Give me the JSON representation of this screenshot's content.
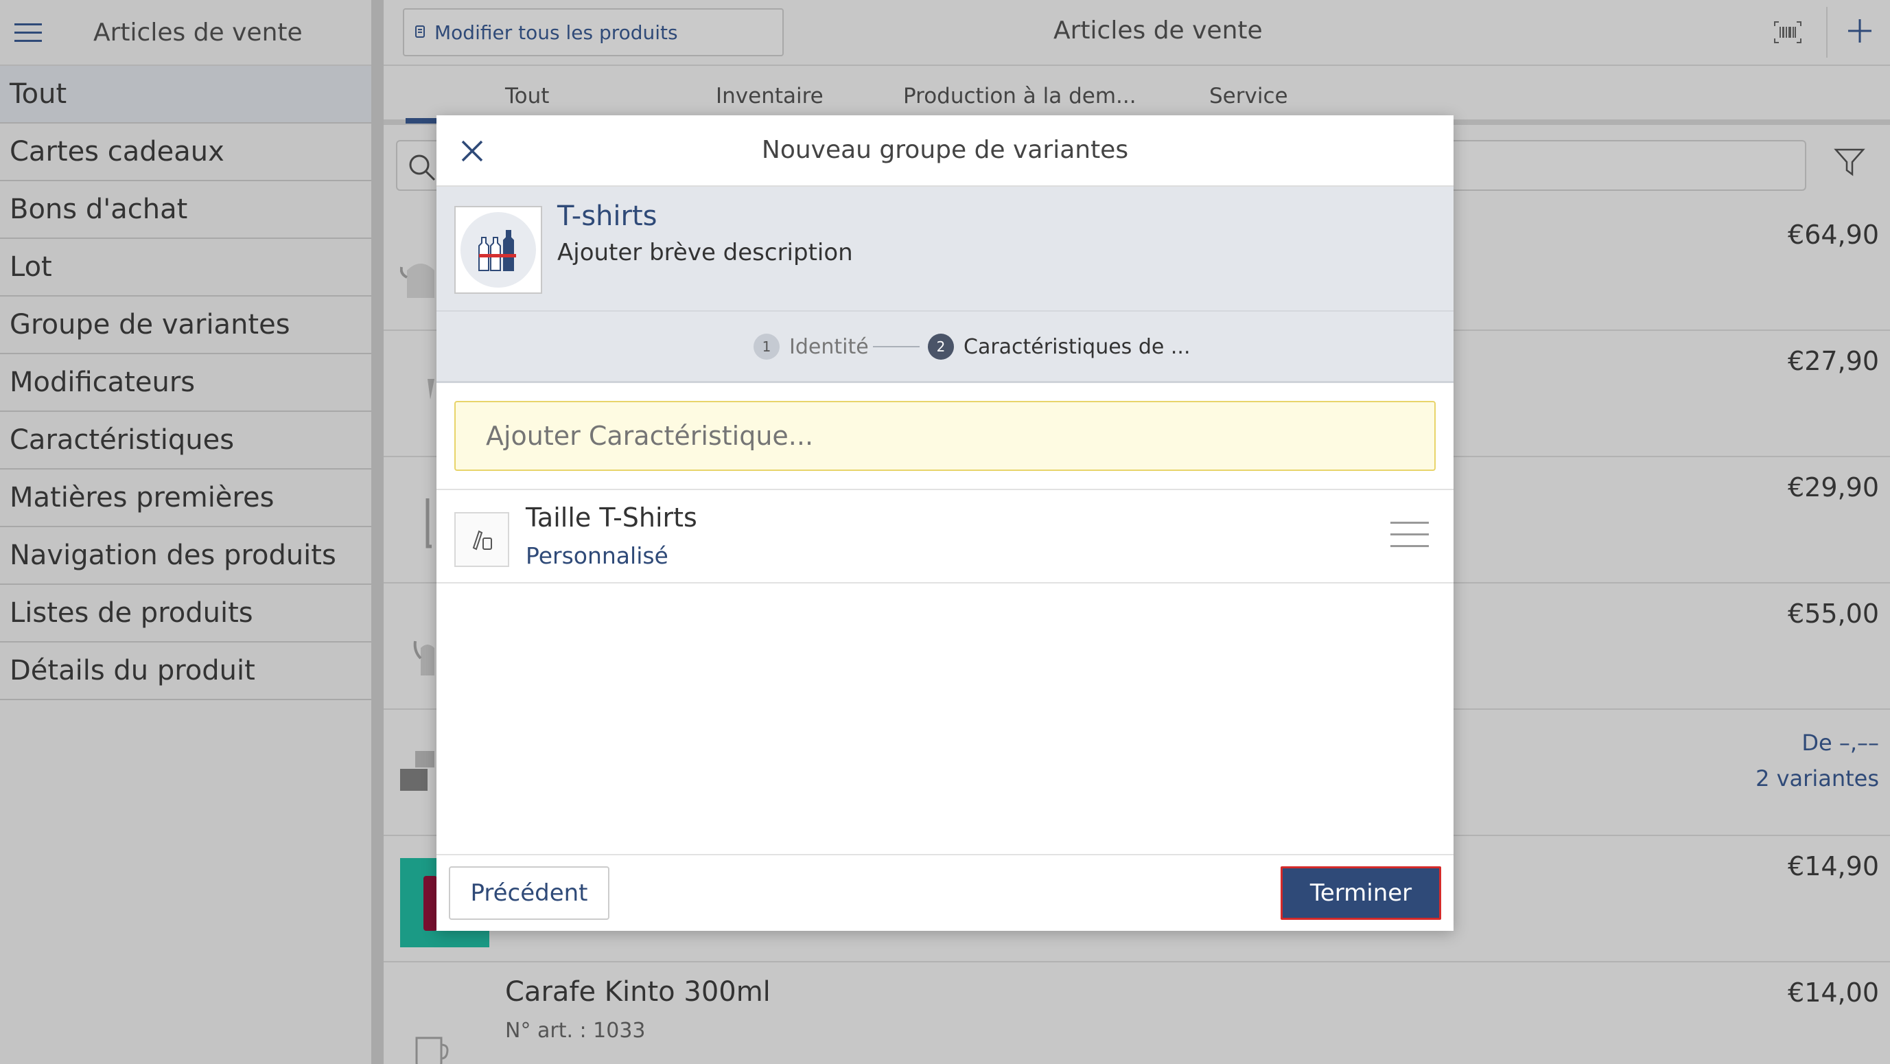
{
  "colors": {
    "accent": "#2f4a78",
    "highlight_border": "#d42a2a",
    "input_bg": "#fefbe2"
  },
  "sidebar": {
    "title": "Articles de vente",
    "items": [
      {
        "label": "Tout",
        "active": true
      },
      {
        "label": "Cartes cadeaux"
      },
      {
        "label": "Bons d'achat"
      },
      {
        "label": "Lot"
      },
      {
        "label": "Groupe de variantes"
      },
      {
        "label": "Modificateurs"
      },
      {
        "label": "Caractéristiques"
      },
      {
        "label": "Matières premières"
      },
      {
        "label": "Navigation des produits"
      },
      {
        "label": "Listes de produits"
      },
      {
        "label": "Détails du produit"
      }
    ]
  },
  "header": {
    "edit_all_label": "Modifier tous les produits",
    "title": "Articles de vente",
    "barcode_icon": "barcode-icon",
    "add_icon": "plus-icon"
  },
  "tabs": [
    {
      "label": "Tout",
      "active": true
    },
    {
      "label": "Inventaire"
    },
    {
      "label": "Production à la dem..."
    },
    {
      "label": "Service"
    }
  ],
  "list": {
    "prices": [
      "€64,90",
      "€27,90",
      "€29,90",
      "€55,00"
    ],
    "variant_row": {
      "from": "De –,––",
      "variants": "2 variantes"
    },
    "price6": "€14,90",
    "last_item": {
      "name": "Carafe Kinto 300ml",
      "code": "N° art. : 1033",
      "price": "€14,00"
    }
  },
  "modal": {
    "title": "Nouveau groupe de variantes",
    "product": {
      "name": "T-shirts",
      "description": "Ajouter brève description"
    },
    "steps": [
      {
        "number": "1",
        "label": "Identité"
      },
      {
        "number": "2",
        "label": "Caractéristiques de ..."
      }
    ],
    "add_placeholder": "Ajouter Caractéristique...",
    "characteristic": {
      "name": "Taille T-Shirts",
      "type": "Personnalisé"
    },
    "prev_label": "Précédent",
    "finish_label": "Terminer"
  }
}
